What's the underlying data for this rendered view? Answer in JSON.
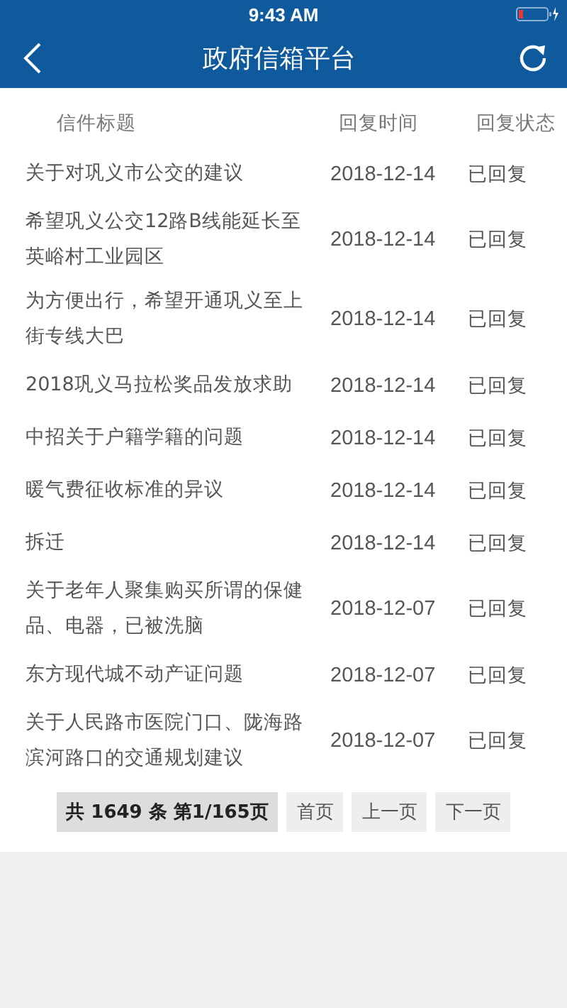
{
  "status_bar": {
    "time": "9:43 AM"
  },
  "nav": {
    "title": "政府信箱平台"
  },
  "table": {
    "columns": [
      "信件标题",
      "回复时间",
      "回复状态"
    ],
    "rows": [
      {
        "title": "关于对巩义市公交的建议",
        "date": "2018-12-14",
        "status": "已回复"
      },
      {
        "title": "希望巩义公交12路B线能延长至英峪村工业园区",
        "date": "2018-12-14",
        "status": "已回复"
      },
      {
        "title": "为方便出行，希望开通巩义至上街专线大巴",
        "date": "2018-12-14",
        "status": "已回复"
      },
      {
        "title": "2018巩义马拉松奖品发放求助",
        "date": "2018-12-14",
        "status": "已回复"
      },
      {
        "title": "中招关于户籍学籍的问题",
        "date": "2018-12-14",
        "status": "已回复"
      },
      {
        "title": "暖气费征收标准的异议",
        "date": "2018-12-14",
        "status": "已回复"
      },
      {
        "title": "拆迁",
        "date": "2018-12-14",
        "status": "已回复"
      },
      {
        "title": "关于老年人聚集购买所谓的保健品、电器，已被洗脑",
        "date": "2018-12-07",
        "status": "已回复"
      },
      {
        "title": "东方现代城不动产证问题",
        "date": "2018-12-07",
        "status": "已回复"
      },
      {
        "title": "关于人民路市医院门口、陇海路滨河路口的交通规划建议",
        "date": "2018-12-07",
        "status": "已回复"
      }
    ]
  },
  "pagination": {
    "summary": "共 1649 条  第1/165页",
    "buttons": [
      "首页",
      "上一页",
      "下一页"
    ]
  }
}
